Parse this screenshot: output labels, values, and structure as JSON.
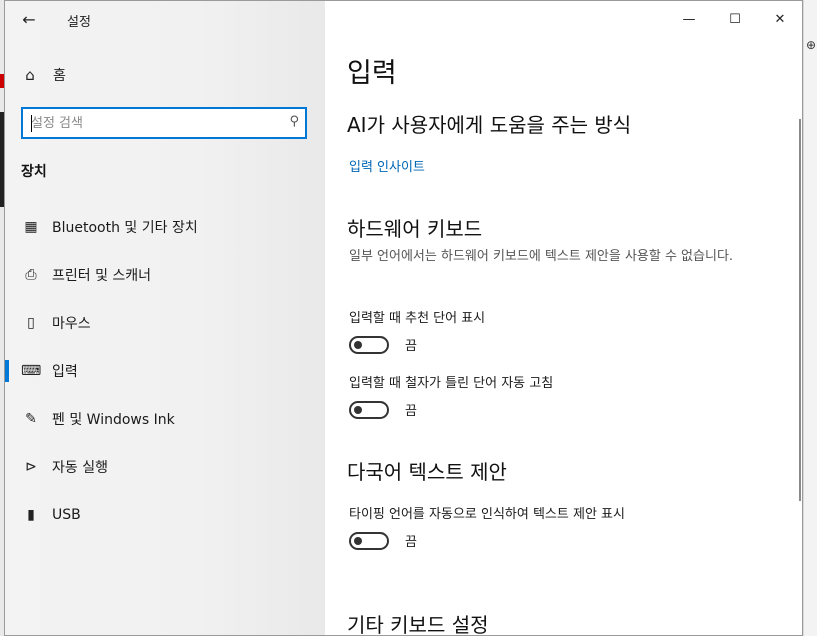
{
  "window": {
    "title": "설정"
  },
  "sidebar": {
    "home_label": "홈",
    "search_placeholder": "설정 검색",
    "group_title": "장치",
    "items": [
      {
        "label": "Bluetooth 및 기타 장치",
        "icon": "bluetooth-devices-icon"
      },
      {
        "label": "프린터 및 스캐너",
        "icon": "printer-icon"
      },
      {
        "label": "마우스",
        "icon": "mouse-icon"
      },
      {
        "label": "입력",
        "icon": "keyboard-icon",
        "active": true
      },
      {
        "label": "펜 및 Windows Ink",
        "icon": "pen-icon"
      },
      {
        "label": "자동 실행",
        "icon": "autoplay-icon"
      },
      {
        "label": "USB",
        "icon": "usb-icon"
      }
    ]
  },
  "main": {
    "title": "입력",
    "ai_section": {
      "heading": "AI가 사용자에게 도움을 주는 방식",
      "link": "입력 인사이트"
    },
    "hardware_section": {
      "heading": "하드웨어 키보드",
      "description": "일부 언어에서는 하드웨어 키보드에 텍스트 제안을 사용할 수 없습니다.",
      "options": [
        {
          "label": "입력할 때 추천 단어 표시",
          "state": "끔"
        },
        {
          "label": "입력할 때 철자가 틀린 단어 자동 고침",
          "state": "끔"
        }
      ]
    },
    "multilingual_section": {
      "heading": "다국어 텍스트 제안",
      "options": [
        {
          "label": "타이핑 언어를 자동으로 인식하여 텍스트 제안 표시",
          "state": "끔"
        }
      ]
    },
    "other_section": {
      "heading": "기타 키보드 설정"
    }
  },
  "colors": {
    "accent": "#0078d7",
    "link": "#0066b4"
  }
}
